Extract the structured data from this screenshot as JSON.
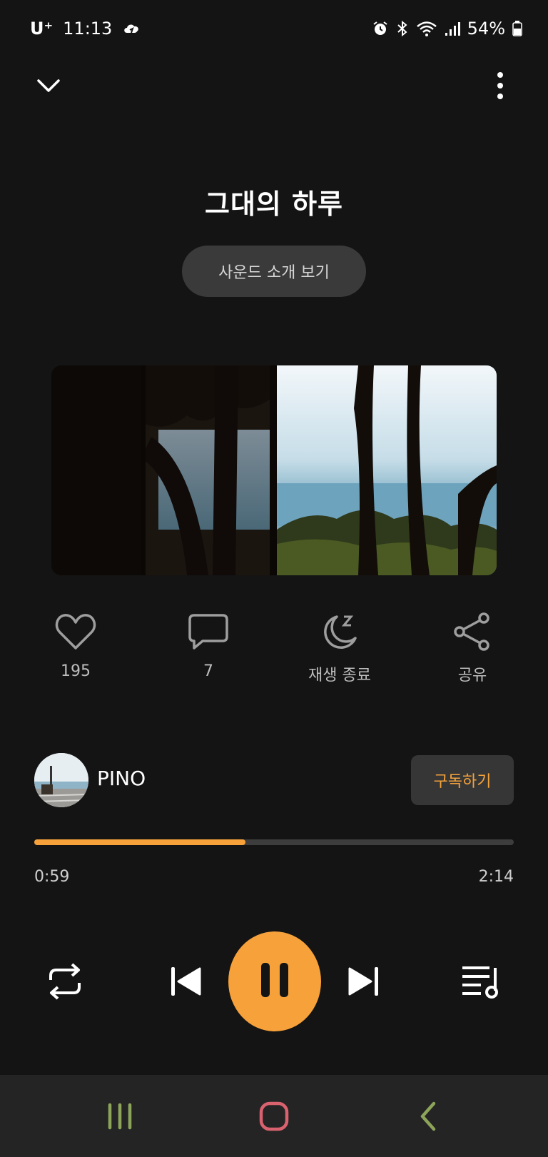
{
  "status_bar": {
    "carrier": "U⁺",
    "time": "11:13",
    "battery": "54%"
  },
  "player": {
    "title": "그대의 하루",
    "intro_button_label": "사운드 소개 보기",
    "actions": {
      "like_count": "195",
      "comment_count": "7",
      "sleep_label": "재생 종료",
      "share_label": "공유"
    },
    "channel": {
      "name": "PINO",
      "subscribe_label": "구독하기"
    },
    "progress": {
      "current": "0:59",
      "total": "2:14",
      "fraction": 0.44
    }
  },
  "colors": {
    "accent": "#f7a13b",
    "background": "#141414",
    "navbar": "#242424"
  },
  "icons": [
    "collapse-chevron-icon",
    "more-options-icon",
    "heart-icon",
    "comment-icon",
    "sleep-timer-icon",
    "share-icon",
    "repeat-icon",
    "previous-icon",
    "pause-icon",
    "next-icon",
    "playlist-icon",
    "recent-apps-icon",
    "home-icon",
    "back-icon"
  ]
}
